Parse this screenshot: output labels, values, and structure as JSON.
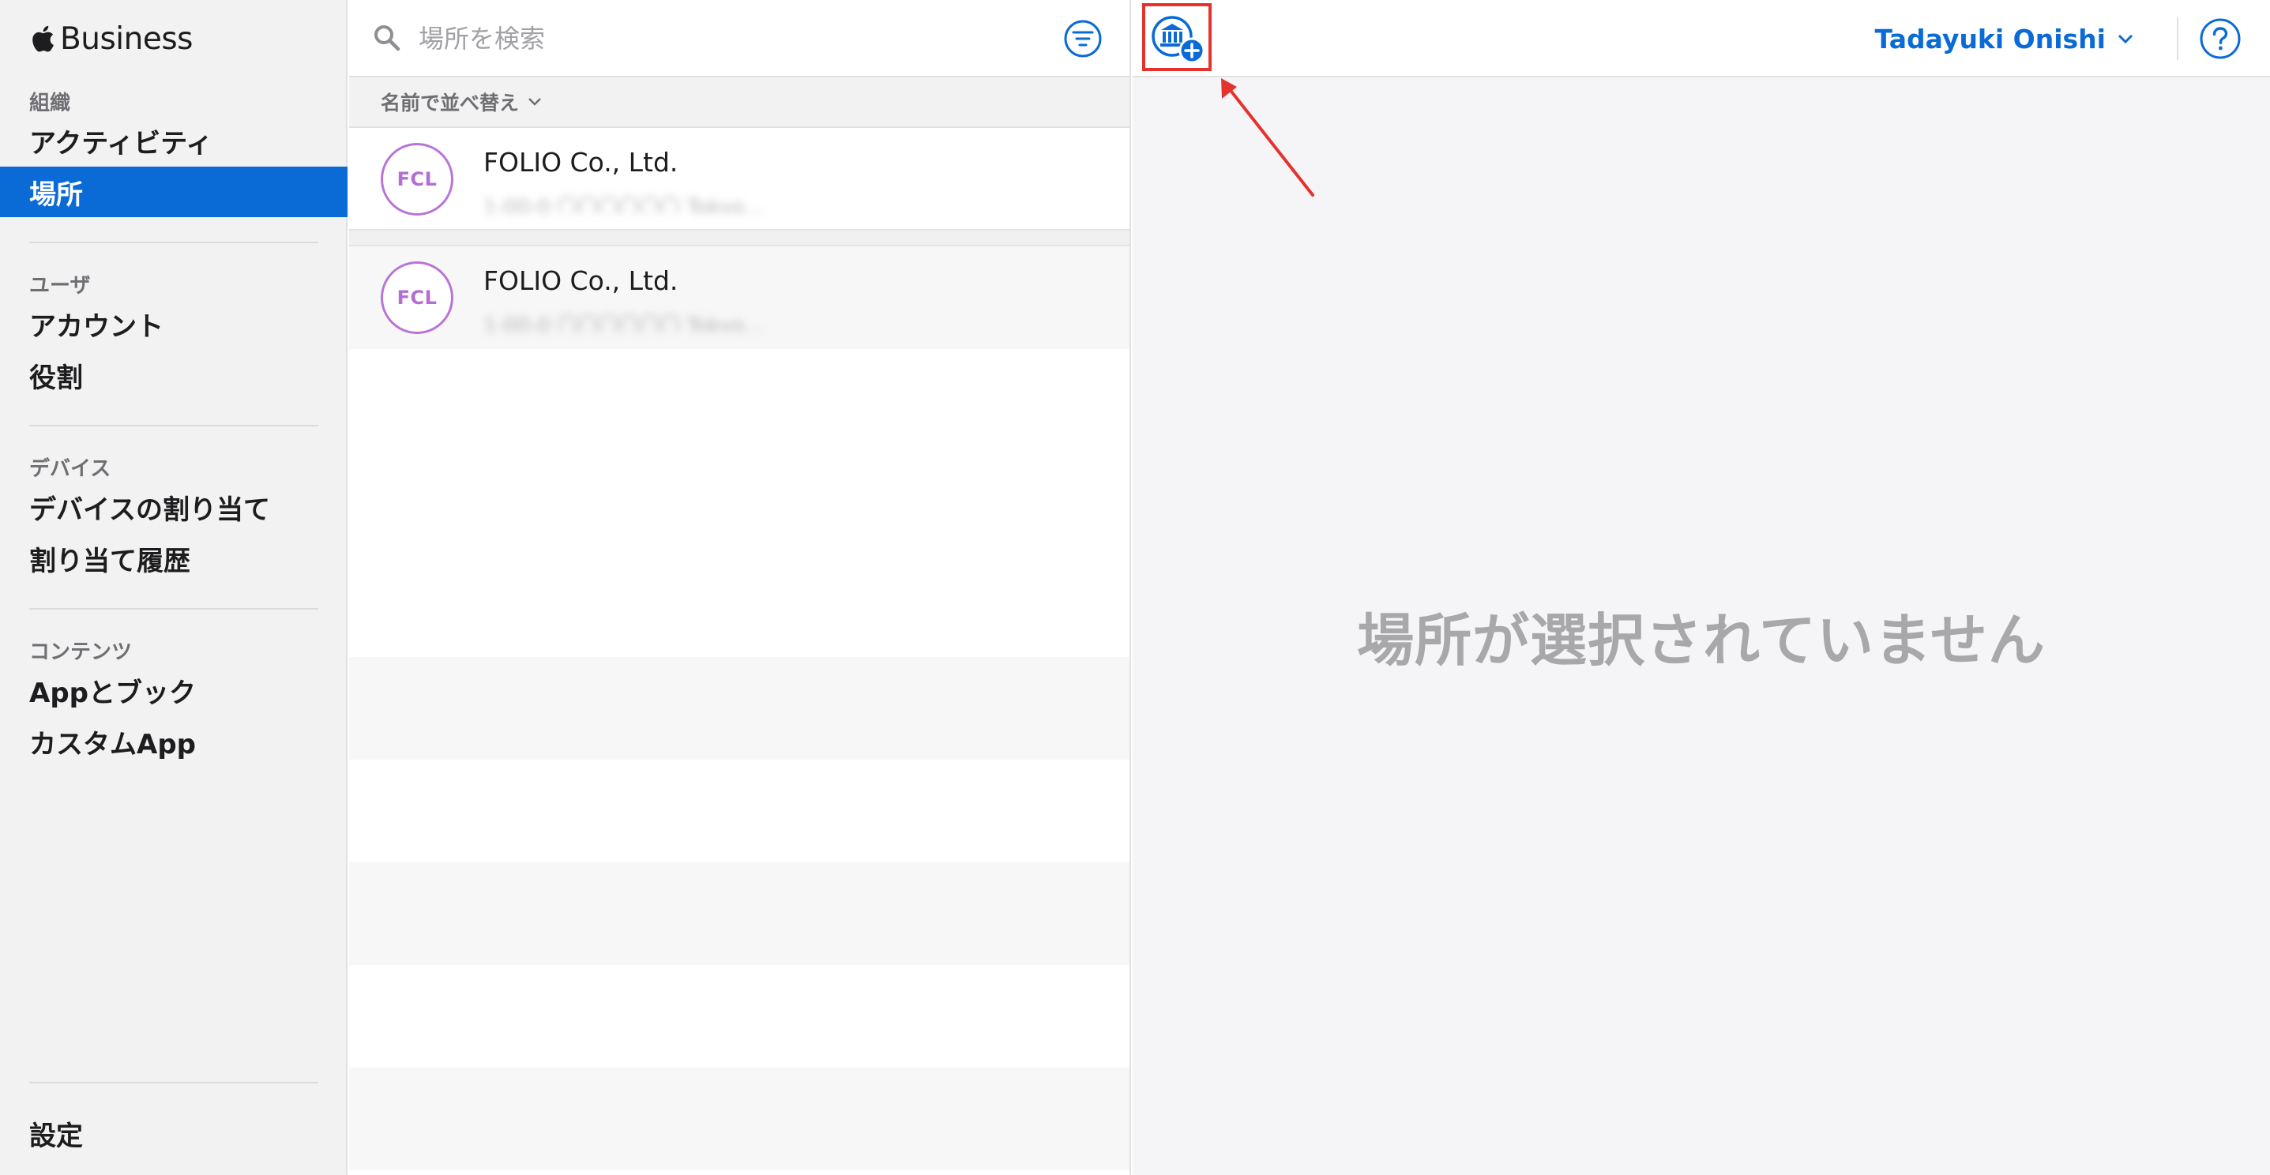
{
  "brand": {
    "name": "Business"
  },
  "sidebar": {
    "sections": [
      {
        "label": "組織",
        "items": [
          "アクティビティ",
          "場所"
        ]
      },
      {
        "label": "ユーザ",
        "items": [
          "アカウント",
          "役割"
        ]
      },
      {
        "label": "デバイス",
        "items": [
          "デバイスの割り当て",
          "割り当て履歴"
        ]
      },
      {
        "label": "コンテンツ",
        "items": [
          "Appとブック",
          "カスタムApp"
        ]
      }
    ],
    "active_item": "場所",
    "footer_item": "設定"
  },
  "list": {
    "search_placeholder": "場所を検索",
    "sort_label": "名前で並べ替え",
    "rows": [
      {
        "initials": "FCL",
        "title": "FOLIO Co., Ltd.",
        "subtitle": "1-00-0 〇〇〇〇〇〇 Tokyo..."
      },
      {
        "initials": "FCL",
        "title": "FOLIO Co., Ltd.",
        "subtitle": "1-00-0 〇〇〇〇〇〇 Tokyo..."
      }
    ]
  },
  "detail": {
    "user_name": "Tadayuki Onishi",
    "empty_message": "場所が選択されていません"
  },
  "colors": {
    "accent": "#0a6bd6",
    "avatar_ring": "#b974d6",
    "highlight": "#e5322d"
  },
  "icons": {
    "brand": "apple-logo-icon",
    "search": "search-icon",
    "filter": "filter-icon",
    "add_location": "add-location-icon",
    "help": "help-icon"
  }
}
